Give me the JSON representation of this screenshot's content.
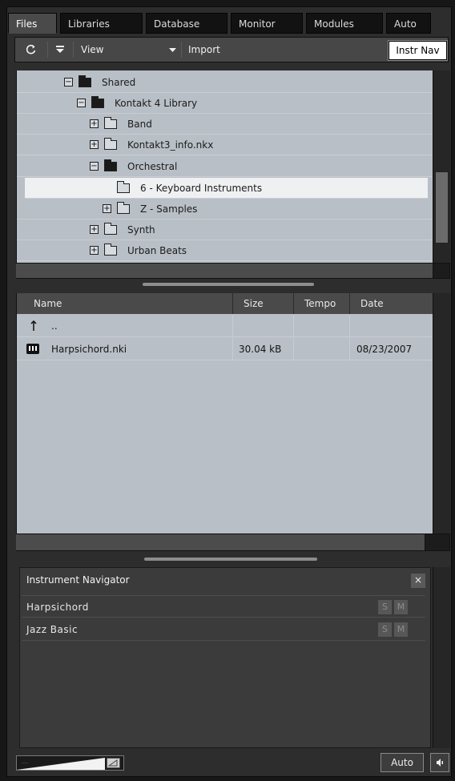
{
  "tabs": [
    "Files",
    "Libraries",
    "Database",
    "Monitor",
    "Modules",
    "Auto"
  ],
  "active_tab": "Files",
  "toolbar": {
    "view_label": "View",
    "import_label": "Import",
    "instr_nav_label": "Instr Nav"
  },
  "tree": {
    "items": [
      {
        "label": "Shared",
        "expanded": true
      },
      {
        "label": "Kontakt 4 Library",
        "expanded": true
      },
      {
        "label": "Band",
        "expanded": false
      },
      {
        "label": "Kontakt3_info.nkx",
        "expanded": false
      },
      {
        "label": "Orchestral",
        "expanded": true
      },
      {
        "label": "6 - Keyboard Instruments",
        "selected": true
      },
      {
        "label": "Z - Samples",
        "expanded": false
      },
      {
        "label": "Synth",
        "expanded": false
      },
      {
        "label": "Urban Beats",
        "expanded": false
      }
    ]
  },
  "file_list": {
    "columns": [
      "Name",
      "Size",
      "Tempo",
      "Date"
    ],
    "up_label": "..",
    "rows": [
      {
        "name": "Harpsichord.nki",
        "size": "30.04 kB",
        "tempo": "",
        "date": "08/23/2007"
      }
    ]
  },
  "navigator": {
    "title": "Instrument Navigator",
    "close_label": "×",
    "solo_label": "S",
    "mute_label": "M",
    "instruments": [
      "Harpsichord",
      "Jazz Basic"
    ]
  },
  "bottom": {
    "auto_label": "Auto"
  },
  "colors": {
    "panel_bg": "#b9bfc6",
    "selection": "#eef0f2",
    "frame": "#2d2d2d"
  }
}
